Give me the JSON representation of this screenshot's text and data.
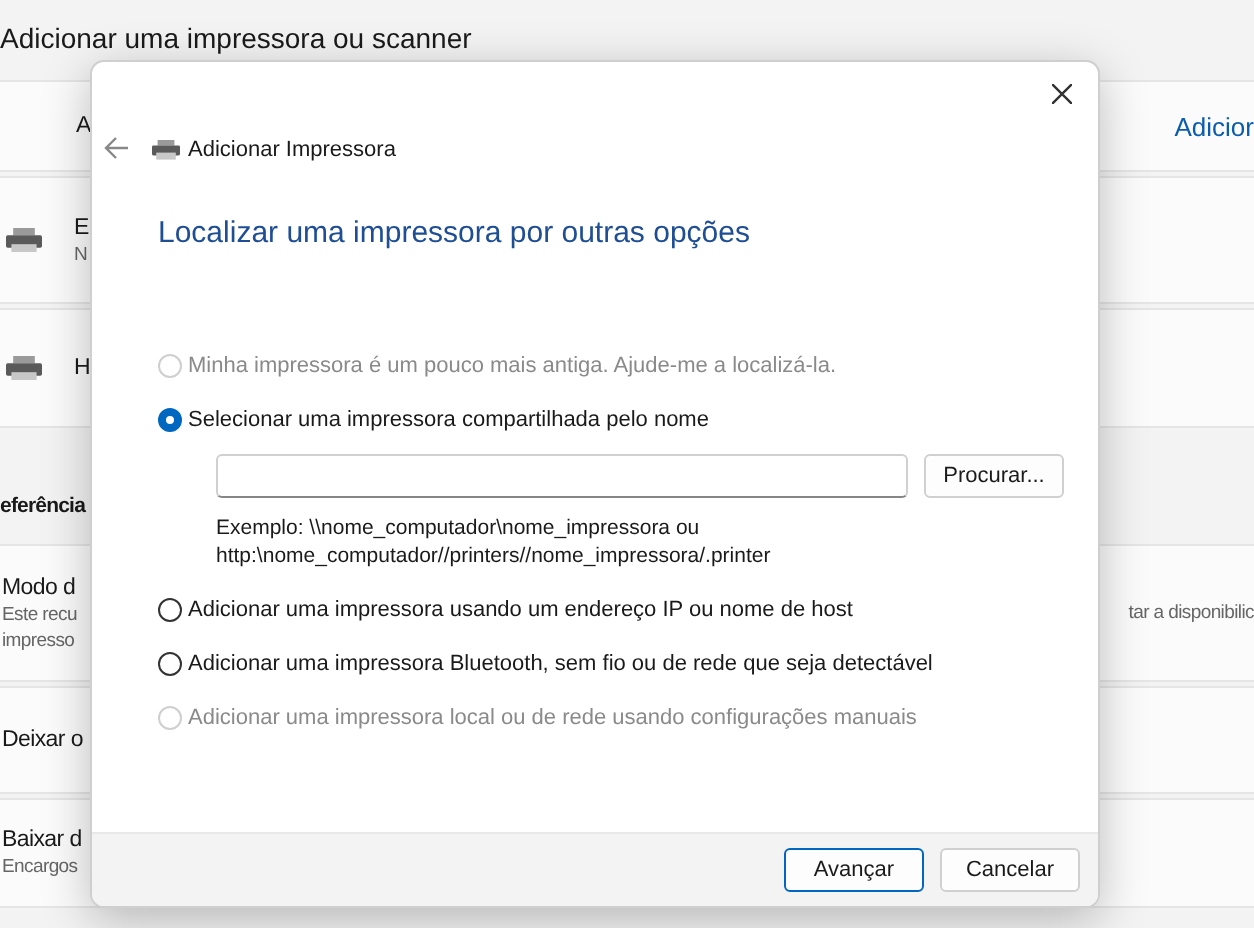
{
  "settings": {
    "title": "Adicionar uma impressora ou scanner",
    "rows": [
      {
        "kind": "plain",
        "lines": [
          "A"
        ],
        "right": "Adicior"
      },
      {
        "kind": "device",
        "lines": [
          "E",
          "N"
        ]
      },
      {
        "kind": "device",
        "lines": [
          "H"
        ]
      },
      {
        "kind": "heading",
        "lines": [
          "eferência"
        ]
      },
      {
        "kind": "plain",
        "lines": [
          "Modo d",
          "Este recu",
          "impresso"
        ],
        "right": "tar a disponibilic"
      },
      {
        "kind": "plain",
        "lines": [
          "Deixar o"
        ]
      },
      {
        "kind": "plain",
        "lines": [
          "Baixar d",
          "Encargos"
        ]
      }
    ]
  },
  "dialog": {
    "title": "Adicionar Impressora",
    "heading": "Localizar uma impressora por outras opções",
    "options": [
      {
        "label": "Minha impressora é um pouco mais antiga. Ajude-me a localizá-la.",
        "selected": false,
        "disabled": true
      },
      {
        "label": "Selecionar uma impressora compartilhada pelo nome",
        "selected": true,
        "disabled": false,
        "field": {
          "button": "Procurar...",
          "example": [
            "Exemplo: \\\\nome_computador\\nome_impressora ou",
            "http:\\nome_computador//printers//nome_impressora/.printer"
          ]
        }
      },
      {
        "label": "Adicionar uma impressora usando um endereço IP ou nome de host",
        "selected": false,
        "disabled": false
      },
      {
        "label": "Adicionar uma impressora Bluetooth, sem fio ou de rede que seja detectável",
        "selected": false,
        "disabled": false
      },
      {
        "label": "Adicionar uma impressora local ou de rede usando configurações manuais",
        "selected": false,
        "disabled": true
      }
    ],
    "buttons": [
      {
        "label": "Avançar",
        "primary": true
      },
      {
        "label": "Cancelar",
        "primary": false
      }
    ]
  }
}
